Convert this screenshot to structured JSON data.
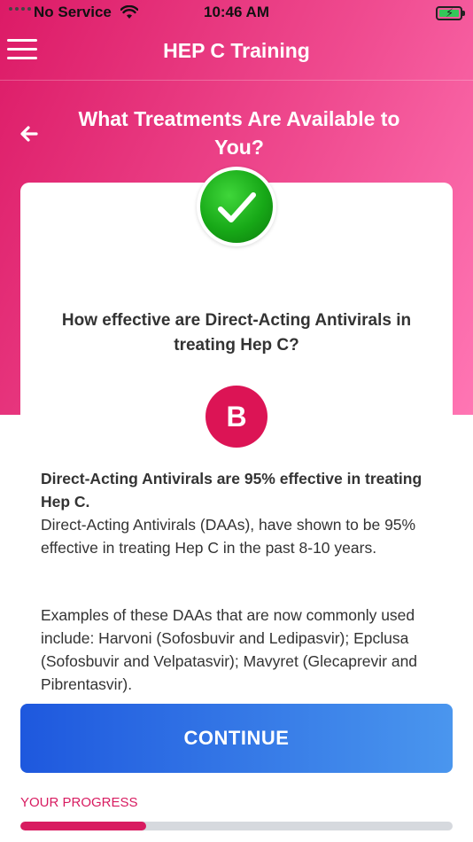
{
  "status_bar": {
    "carrier": "No Service",
    "time": "10:46 AM",
    "battery": "charging"
  },
  "header": {
    "app_title": "HEP C Training",
    "menu_icon": "hamburger-icon"
  },
  "lesson": {
    "title": "What Treatments Are Available to You?",
    "back_icon": "arrow-left-icon"
  },
  "card": {
    "status_icon": "checkmark-icon",
    "question": "How effective are Direct-Acting Antivirals in treating Hep C?",
    "answer_letter": "B",
    "answer_heading": "Direct-Acting Antivirals are 95% effective in treating Hep C.",
    "answer_body": "Direct-Acting Antivirals (DAAs), have shown to be 95% effective in treating Hep C in the past 8-10 years.",
    "examples": "Examples of these DAAs that are now commonly used include: Harvoni (Sofosbuvir and Ledipasvir); Epclusa (Sofosbuvir and Velpatasvir); Mavyret (Glecaprevir and Pibrentasvir)."
  },
  "footer": {
    "continue_label": "CONTINUE",
    "progress_label": "YOUR PROGRESS",
    "progress_fraction": 0.29
  },
  "colors": {
    "accent": "#dc1455",
    "header_gradient_start": "#dc1a66",
    "header_gradient_end": "#ff76b4",
    "button_gradient_start": "#1e58de",
    "button_gradient_end": "#4a96ee",
    "success": "#17a817"
  }
}
